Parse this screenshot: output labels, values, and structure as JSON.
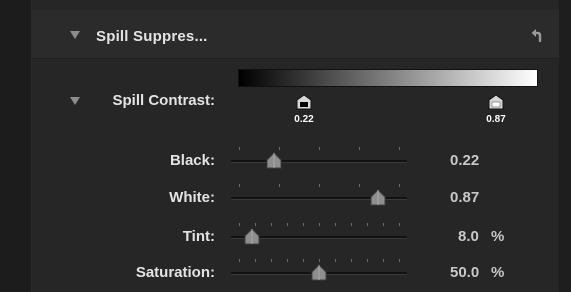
{
  "header": {
    "title": "Spill Suppres...",
    "reset_icon": "reset-arrow-icon"
  },
  "spill_contrast": {
    "label": "Spill Contrast:",
    "gradient": {
      "start_color": "#000000",
      "end_color": "#ffffff"
    },
    "black_point": "0.22",
    "white_point": "0.87"
  },
  "params": [
    {
      "label": "Black:",
      "value": "0.22",
      "unit": "",
      "level": 0.22
    },
    {
      "label": "White:",
      "value": "0.87",
      "unit": "",
      "level": 0.87
    },
    {
      "label": "Tint:",
      "value": "8.0",
      "unit": "%",
      "level": 0.08
    },
    {
      "label": "Saturation:",
      "value": "50.0",
      "unit": "%",
      "level": 0.5
    }
  ],
  "colors": {
    "panel_bg": "#262626",
    "header_bg": "#2b2b2b",
    "label_text": "#e3e3e3",
    "value_text": "#c8c8c8"
  }
}
